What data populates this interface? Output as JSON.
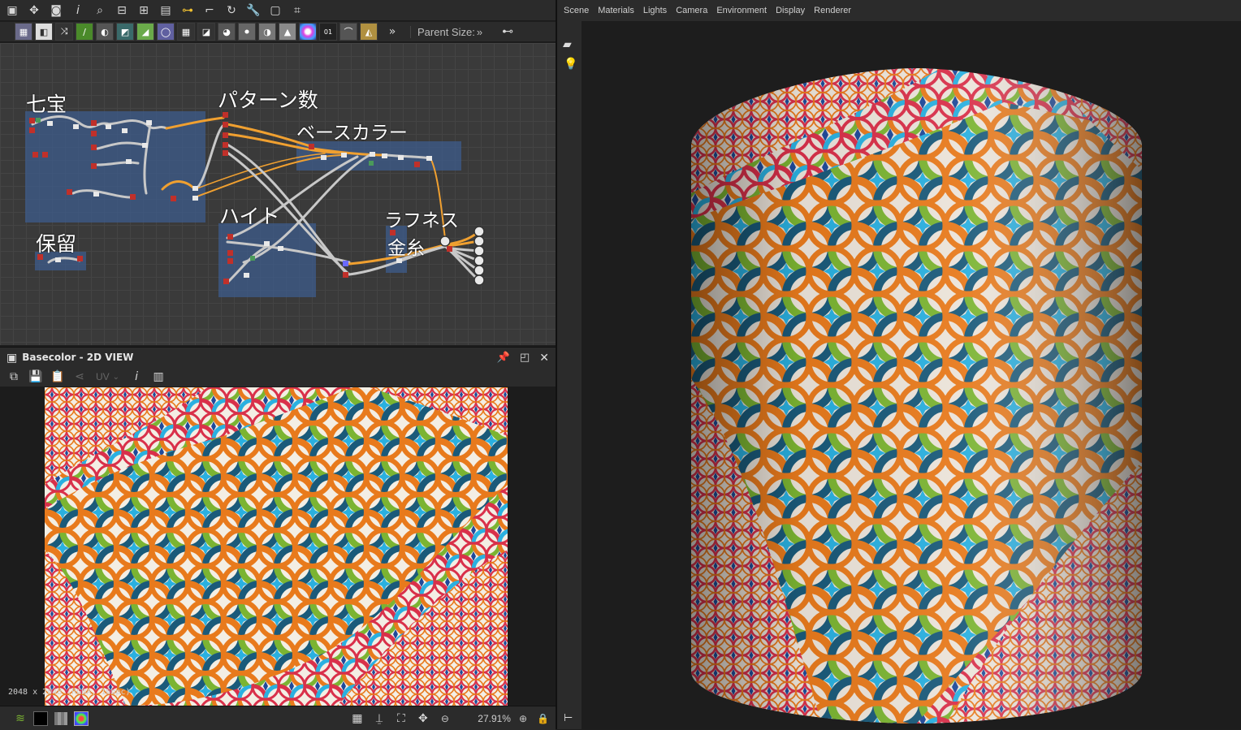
{
  "graph_toolbar": {
    "icons": [
      "frame-icon",
      "move-icon",
      "camera-icon",
      "info-icon",
      "search-icon",
      "align-icon",
      "node-icon",
      "layout-icon",
      "link-icon",
      "connector-icon",
      "cycle-icon",
      "tools-icon",
      "display-icon",
      "crop-icon"
    ],
    "atomic_nodes": [
      "bitmap-icon",
      "svg-icon",
      "transform-icon",
      "curve-icon",
      "uniform-color-icon",
      "warp-icon",
      "gradient-icon",
      "blur-icon",
      "grid-icon",
      "fill-icon",
      "blend-icon",
      "levels-icon",
      "channel-icon",
      "histogram-icon",
      "hsl-icon",
      "pixel-icon",
      "shuffle-icon",
      "emboss-icon"
    ],
    "more_label": "»",
    "parent_size_label": "Parent Size:",
    "parent_size_more": "»"
  },
  "graph": {
    "frames": {
      "shippou": "七宝",
      "pattern_count": "パターン数",
      "base_color": "ベースカラー",
      "height": "ハイト",
      "roughness": "ラフネス",
      "gold_thread": "金糸",
      "reserved": "保留"
    }
  },
  "view2d": {
    "title": "Basecolor - 2D VIEW",
    "tools": [
      "copy-icon",
      "save-icon",
      "paste-icon",
      "share-icon",
      "UV",
      "info-icon",
      "histogram-icon"
    ],
    "uv_label": "UV",
    "info": "2048 x 2048 (RGBA, 16bpc)",
    "zoom": "27.91%"
  },
  "view3d": {
    "menu": [
      "Scene",
      "Materials",
      "Lights",
      "Camera",
      "Environment",
      "Display",
      "Renderer"
    ]
  },
  "colors": {
    "panel": "#2b2b2b",
    "frame": "#3e5c8c",
    "wire_orange": "#f0a030",
    "pattern_red": "#d9304a",
    "pattern_orange": "#e87a1c",
    "pattern_green": "#7bb432",
    "pattern_blue": "#1a5a7a",
    "pattern_cyan": "#2ab0e0"
  }
}
